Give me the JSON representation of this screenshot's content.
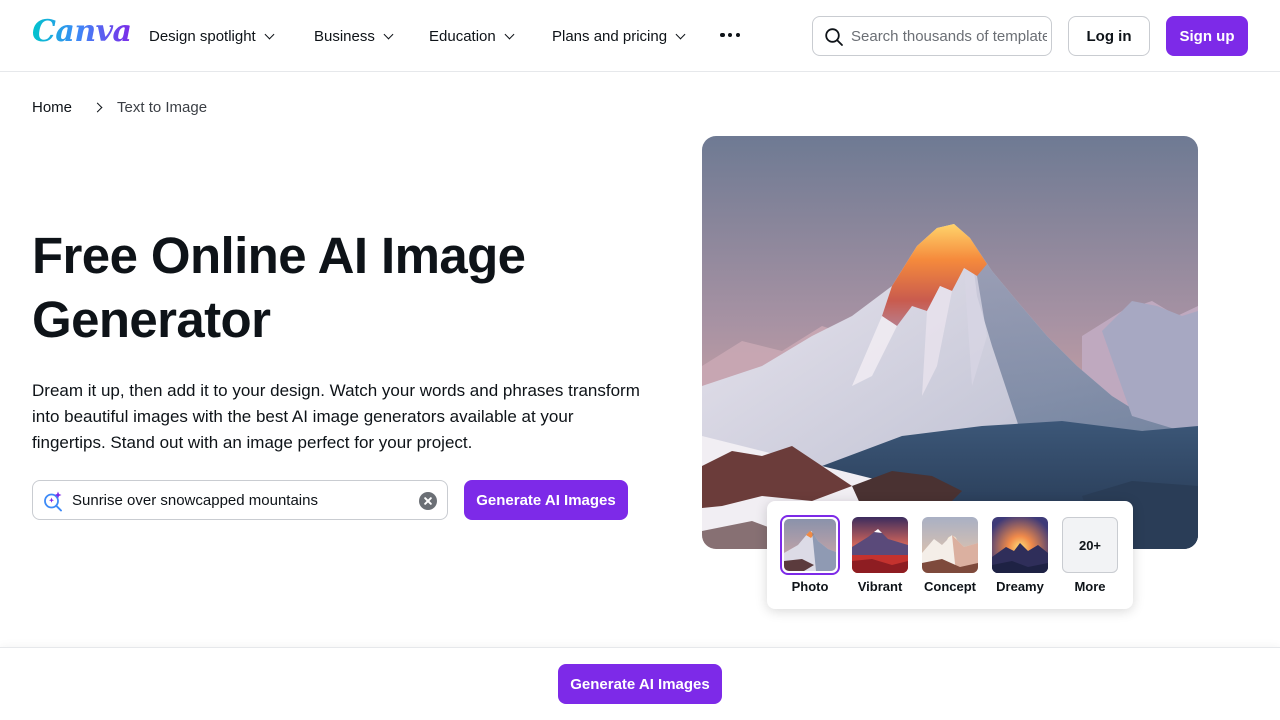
{
  "header": {
    "logo_text": "Canva",
    "nav": [
      {
        "label": "Design spotlight"
      },
      {
        "label": "Business"
      },
      {
        "label": "Education"
      },
      {
        "label": "Plans and pricing"
      }
    ],
    "more_icon": "more-horizontal-icon",
    "search": {
      "placeholder": "Search thousands of templates",
      "icon": "search-icon"
    },
    "login_label": "Log in",
    "signup_label": "Sign up"
  },
  "breadcrumb": {
    "home": "Home",
    "current": "Text to Image"
  },
  "hero": {
    "title": "Free Online AI Image Generator",
    "description": "Dream it up, then add it to your design. Watch your words and phrases transform into beautiful images with the best AI image generators available at your fingertips. Stand out with an image perfect for your project.",
    "prompt": {
      "value": "Sunrise over snowcapped mountains",
      "icon": "ai-search-icon"
    },
    "generate_label": "Generate AI Images"
  },
  "styles": {
    "options": [
      {
        "label": "Photo",
        "selected": true
      },
      {
        "label": "Vibrant",
        "selected": false
      },
      {
        "label": "Concept",
        "selected": false
      },
      {
        "label": "Dreamy",
        "selected": false
      }
    ],
    "more": {
      "count_label": "20+",
      "label": "More"
    }
  },
  "sticky": {
    "generate_label": "Generate AI Images"
  },
  "colors": {
    "brand_purple": "#7d2ae8",
    "text": "#0e1318",
    "border": "#c9ccd1"
  }
}
